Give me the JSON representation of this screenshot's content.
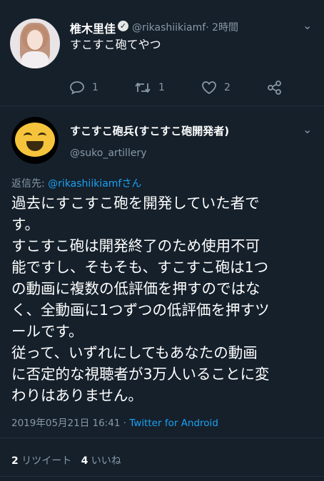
{
  "tweet1": {
    "name": "椎木里佳",
    "handle": "@rikashiikiamf",
    "time": "· 2時間",
    "text": "すこすこ砲てやつ",
    "replies": "1",
    "retweets": "1",
    "likes": "2"
  },
  "tweet2": {
    "name": "すこすこ砲兵(すこすこ砲開発者)",
    "handle": "@suko_artillery",
    "reply_prefix": "返信先: ",
    "reply_to": "@rikashiikiamfさん",
    "lines": [
      "過去にすこすこ砲を開発していた者で",
      "す。",
      "すこすこ砲は開発終了のため使用不可",
      "能ですし、そもそも、すこすこ砲は1つ",
      "の動画に複数の低評価を押すのではな",
      "く、全動画に1つずつの低評価を押すツ",
      "ールです。",
      "従って、いずれにしてもあなたの動画",
      "に否定的な視聴者が3万人いることに変",
      "わりはありません。"
    ],
    "datetime": "2019年05月21日 16:41",
    "separator": " · ",
    "source": "Twitter for Android",
    "retweet_count": "2",
    "retweet_label": "リツイート",
    "like_count": "4",
    "like_label": "いいね"
  },
  "icons": {
    "verified": "verified-badge-icon",
    "menu": "chevron-down-icon",
    "reply": "reply-bubble-icon",
    "retweet": "retweet-icon",
    "like": "heart-icon",
    "share": "share-icon"
  },
  "colors": {
    "background": "#15202b",
    "muted": "#8899a6",
    "link": "#1da1f2"
  }
}
